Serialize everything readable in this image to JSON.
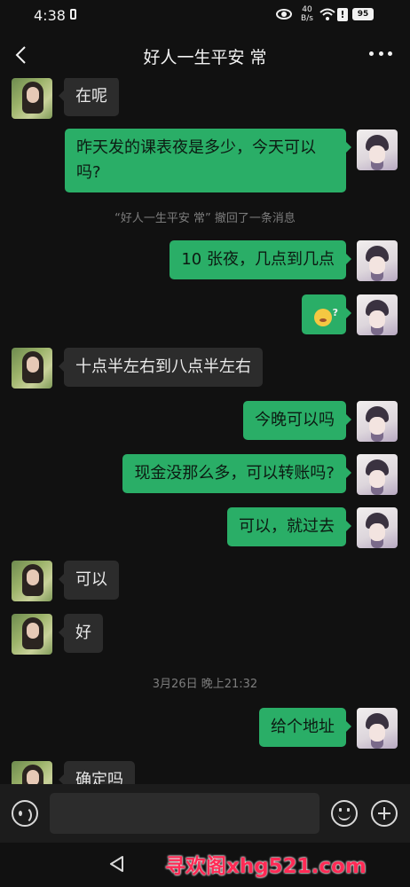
{
  "status_bar": {
    "time": "4:38",
    "net_speed_value": "40",
    "net_speed_unit": "B/s",
    "alert": "!",
    "battery": "95",
    "icons": [
      "lock-icon",
      "eye-icon",
      "wifi-icon",
      "alert-icon",
      "battery-icon"
    ]
  },
  "nav": {
    "title": "好人一生平安 常",
    "back_icon": "chevron-left-icon",
    "more_icon": "more-dots-icon"
  },
  "messages": [
    {
      "side": "left",
      "text": "在呢"
    },
    {
      "side": "right",
      "text": "昨天发的课表夜是多少，今天可以吗?"
    },
    {
      "side": "system",
      "text": "“好人一生平安 常” 撤回了一条消息"
    },
    {
      "side": "right",
      "text": "10 张夜，几点到几点"
    },
    {
      "side": "right",
      "text": "",
      "sticker": "confused-emoji"
    },
    {
      "side": "left",
      "text": "十点半左右到八点半左右"
    },
    {
      "side": "right",
      "text": "今晚可以吗"
    },
    {
      "side": "right",
      "text": "现金没那么多，可以转账吗?"
    },
    {
      "side": "right",
      "text": "可以，就过去"
    },
    {
      "side": "left",
      "text": "可以"
    },
    {
      "side": "left",
      "text": "好"
    },
    {
      "side": "system",
      "text": "3月26日 晚上21:32"
    },
    {
      "side": "right",
      "text": "给个地址"
    },
    {
      "side": "left",
      "text": "确定吗"
    }
  ],
  "input_bar": {
    "placeholder": "",
    "icons": [
      "voice-icon",
      "emoji-icon",
      "plus-icon"
    ]
  },
  "system_nav": {
    "back_icon": "triangle-back-icon"
  },
  "watermark": "寻欢阁xhg521.com",
  "colors": {
    "background": "#111111",
    "bubble_left": "#2c2c2c",
    "bubble_right": "#2aae67",
    "system_text": "#7d7d7d",
    "watermark": "#ff2a55"
  }
}
